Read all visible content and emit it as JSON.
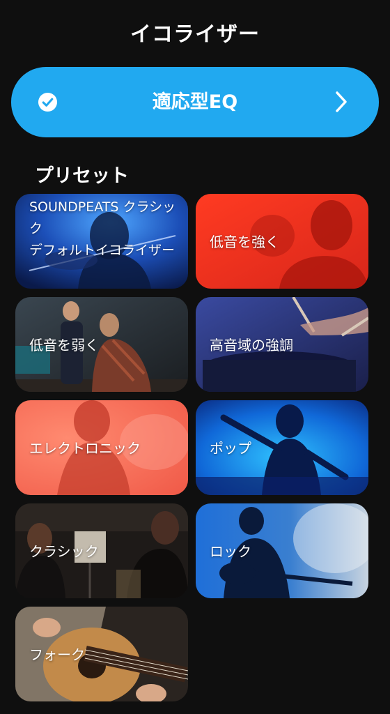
{
  "header": {
    "title": "イコライザー"
  },
  "adaptive_eq": {
    "label": "適応型EQ",
    "icon": "check-circle-icon",
    "chevron_icon": "chevron-right-icon",
    "color": "#21a9f0"
  },
  "presets": {
    "section_title": "プリセット",
    "items": [
      {
        "label": "SOUNDPEATS クラシック",
        "sublabel": "デフォルトイコライザー",
        "selected": true
      },
      {
        "label": "低音を強く"
      },
      {
        "label": "低音を弱く"
      },
      {
        "label": "高音域の強調"
      },
      {
        "label": "エレクトロニック"
      },
      {
        "label": "ポップ"
      },
      {
        "label": "クラシック"
      },
      {
        "label": "ロック"
      },
      {
        "label": "フォーク"
      }
    ]
  }
}
